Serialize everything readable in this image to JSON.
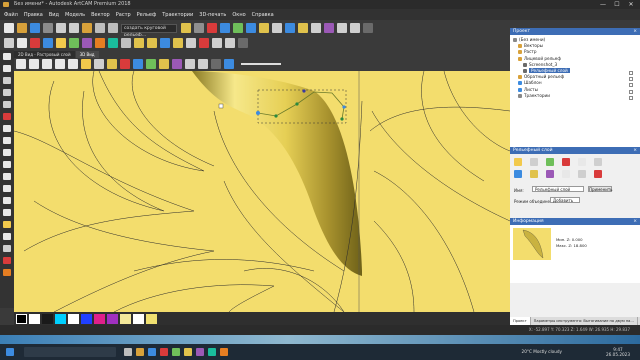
{
  "window": {
    "title": "Без имени* - Autodesk ArtCAM Premium 2018",
    "controls": [
      "—",
      "☐",
      "✕"
    ]
  },
  "menu": [
    "Файл",
    "Правка",
    "Вид",
    "Модель",
    "Вектор",
    "Растр",
    "Рельеф",
    "Траектории",
    "3D-печать",
    "Окно",
    "Справка"
  ],
  "toolbar": {
    "relief_dropdown": "создать круговой рельеф...",
    "colors": [
      "#d93b3b",
      "#3c8be0",
      "#f2c94c",
      "#6fbf5a",
      "#9b59b6",
      "#e67e22",
      "#1abc9c",
      "#c0c0c0"
    ]
  },
  "view_tabs": [
    "2D Вид - Растровый слой",
    "3D Вид"
  ],
  "palette": {
    "colors": [
      "#000000",
      "#ffffff",
      "#1a1a1a",
      "#00d0ff",
      "#ffffff",
      "#2040ff",
      "#e0208a",
      "#a030c0",
      "#f4e89a",
      "#ffffff",
      "#f0e070"
    ]
  },
  "project_panel": {
    "title": "Проект",
    "items": [
      {
        "label": "(Без имени)",
        "indent": 0,
        "icon": "#888888",
        "selected": false
      },
      {
        "label": "Векторы",
        "indent": 1,
        "icon": "#d8a13a",
        "selected": false
      },
      {
        "label": "Растр",
        "indent": 1,
        "icon": "#d8a13a",
        "selected": false
      },
      {
        "label": "Лицевой рельеф",
        "indent": 1,
        "icon": "#d8a13a",
        "selected": false
      },
      {
        "label": "Screenshot_3",
        "indent": 2,
        "icon": "#6a6a6a",
        "selected": false
      },
      {
        "label": "Рельефный слой",
        "indent": 2,
        "icon": "#6a6a6a",
        "selected": true
      },
      {
        "label": "Обратный рельеф",
        "indent": 1,
        "icon": "#d8a13a",
        "selected": false
      },
      {
        "label": "Шаблон",
        "indent": 1,
        "icon": "#3c8be0",
        "selected": false
      },
      {
        "label": "Листы",
        "indent": 1,
        "icon": "#3c8be0",
        "selected": false
      },
      {
        "label": "Траектории",
        "indent": 1,
        "icon": "#888888",
        "selected": false
      }
    ]
  },
  "relief_panel": {
    "title": "Рельефный слой",
    "name_label": "Имя:",
    "name_value": "Рельефный слой",
    "apply_label": "Применить",
    "combine_label": "Режим объединения:",
    "combine_value": "Добавить"
  },
  "info_panel": {
    "title": "Информация",
    "min_z": "Мин. Z: 0.000",
    "max_z": "Макс. Z: 18.800"
  },
  "panel_tabs": [
    "Проект",
    "Параметры инструмента: Вытягивание по двум на..."
  ],
  "status": {
    "coords": "X: -52.897   Y: 70.323   Z: 1.649      W: 26.935   H: 29.837"
  },
  "taskbar": {
    "weather": "20°C  Mostly cloudy",
    "time": "9:47",
    "date": "26.05.2023"
  }
}
